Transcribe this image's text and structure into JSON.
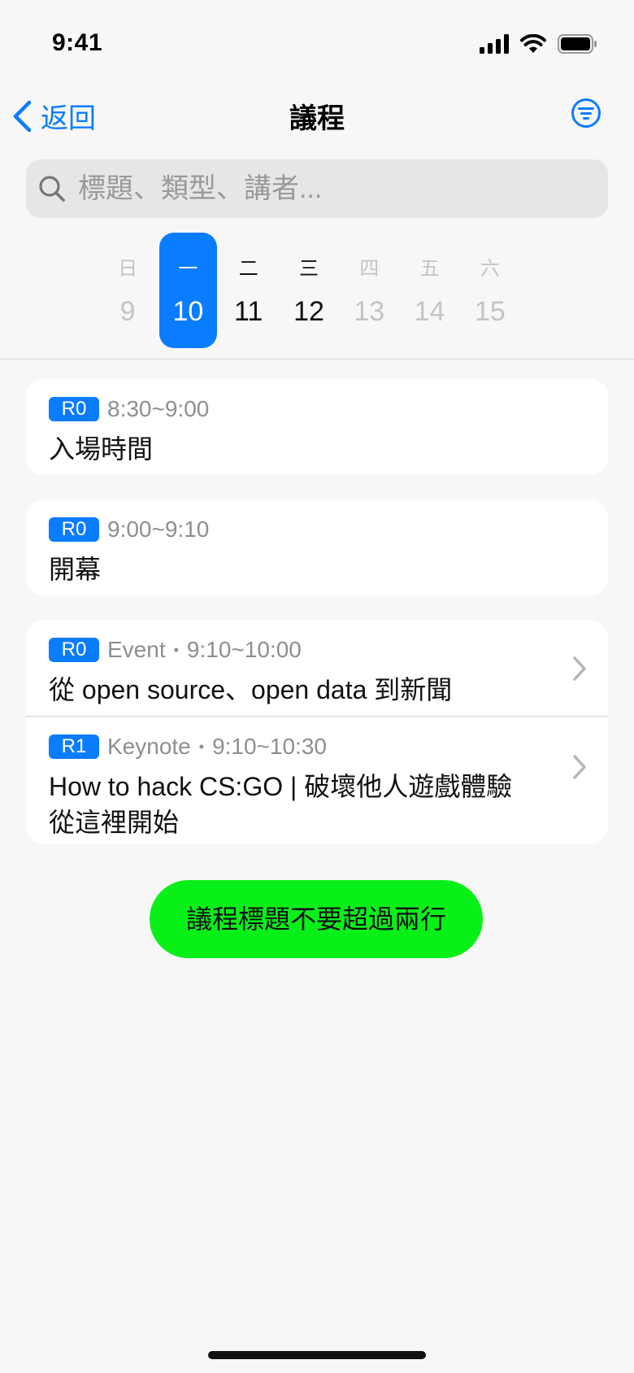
{
  "status": {
    "time": "9:41"
  },
  "nav": {
    "back_label": "返回",
    "title": "議程"
  },
  "search": {
    "placeholder": "標題、類型、講者..."
  },
  "week": [
    {
      "weekday": "日",
      "date": "9",
      "state": "disabled"
    },
    {
      "weekday": "一",
      "date": "10",
      "state": "selected"
    },
    {
      "weekday": "二",
      "date": "11",
      "state": "normal"
    },
    {
      "weekday": "三",
      "date": "12",
      "state": "normal"
    },
    {
      "weekday": "四",
      "date": "13",
      "state": "disabled"
    },
    {
      "weekday": "五",
      "date": "14",
      "state": "disabled"
    },
    {
      "weekday": "六",
      "date": "15",
      "state": "disabled"
    }
  ],
  "sessions": [
    {
      "room": "R0",
      "time": "8:30~9:00",
      "title": "入場時間"
    },
    {
      "room": "R0",
      "time": "9:00~9:10",
      "title": "開幕"
    },
    {
      "room": "R0",
      "type": "Event",
      "time": "9:10~10:00",
      "title": "從 open source、open data 到新聞"
    },
    {
      "room": "R1",
      "type": "Keynote",
      "time": "9:10~10:30",
      "title": "How to hack CS:GO | 破壞他人遊戲體驗從這裡開始"
    }
  ],
  "cta": {
    "label": "議程標題不要超過兩行"
  },
  "colors": {
    "accent": "#0a7cff",
    "cta": "#09f019",
    "background": "#f7f7f7"
  }
}
